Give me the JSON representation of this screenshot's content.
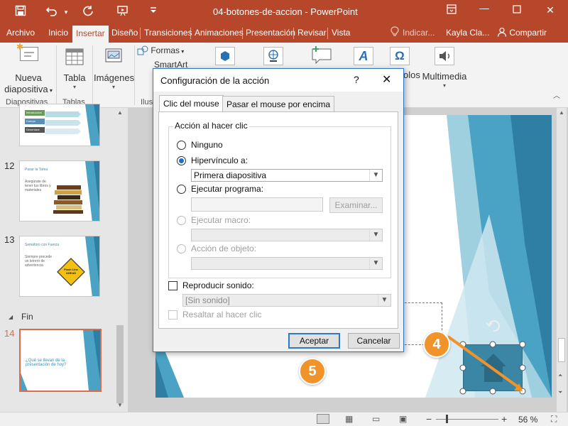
{
  "window": {
    "title": "04-botones-de-accion  -  PowerPoint",
    "quick_access": [
      "save-icon",
      "undo-icon",
      "redo-icon",
      "present-icon",
      "customize-icon"
    ],
    "controls": [
      "ribbon-display-icon",
      "minimize-icon",
      "maximize-icon",
      "close-icon"
    ]
  },
  "tabs": [
    "Archivo",
    "Inicio",
    "Insertar",
    "Diseño",
    "Transiciones",
    "Animaciones",
    "Presentación",
    "Revisar",
    "Vista"
  ],
  "active_tab": "Insertar",
  "tell_me": "Indicar...",
  "user": "Kayla Cla...",
  "share": "Compartir",
  "ribbon": {
    "nueva_line1": "Nueva",
    "nueva_line2": "diapositiva",
    "tabla": "Tabla",
    "imagenes": "Imágenes",
    "formas": "Formas",
    "smartart": "SmartArt",
    "vinculos_partial": "olos",
    "multimedia": "Multimedia",
    "group_diapositivas": "Diapositivas",
    "group_tablas": "Tablas",
    "group_ilus": "Ilus"
  },
  "thumbs": {
    "n12": "12",
    "n13": "13",
    "n14": "14",
    "section_fin": "Fin",
    "s11_items": [
      "Introducción",
      "Cuerpo",
      "Desenlace"
    ],
    "s12_title": "Pasar la Tarea",
    "s12_text": "Asegúrate de tener tus libros y materiales",
    "s13_title": "Semáforo con Fuerza",
    "s13_text": "Siempre precede un letrero de advertencia",
    "s13_sign": "Flash Line AHEAD",
    "s14_text": "¿Qué se llevan de la presentación de hoy?"
  },
  "dialog": {
    "title": "Configuración de la acción",
    "help": "?",
    "close": "✕",
    "tab_click": "Clic del mouse",
    "tab_hover": "Pasar el mouse por encima",
    "legend": "Acción al hacer clic",
    "opt_none": "Ninguno",
    "opt_hyperlink": "Hipervínculo a:",
    "hyperlink_value": "Primera diapositiva",
    "opt_program": "Ejecutar programa:",
    "program_value": "",
    "browse": "Examinar...",
    "opt_macro": "Ejecutar macro:",
    "opt_object": "Acción de objeto:",
    "play_sound": "Reproducir sonido:",
    "sound_value": "[Sin sonido]",
    "highlight": "Resaltar al hacer clic",
    "ok": "Aceptar",
    "cancel": "Cancelar"
  },
  "selected_option": "Hipervínculo a:",
  "callouts": [
    "4",
    "5"
  ],
  "status": {
    "zoom": "56 %",
    "minus": "−",
    "plus": "+"
  },
  "colors": {
    "brand": "#b7472a",
    "accent_blue": "#3d8fb1",
    "callout": "#f0932b",
    "dialog_border": "#2b79c8"
  }
}
